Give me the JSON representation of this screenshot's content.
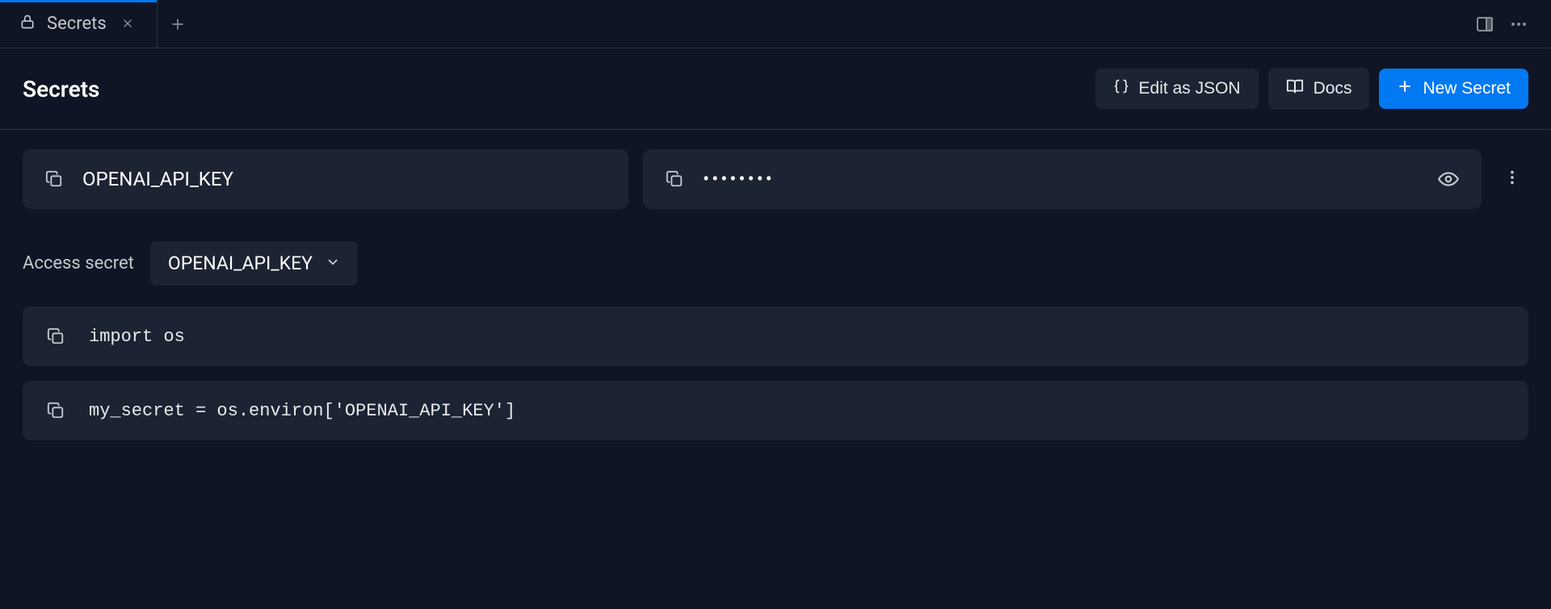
{
  "tab": {
    "label": "Secrets"
  },
  "header": {
    "title": "Secrets",
    "edit_json_label": "Edit as JSON",
    "docs_label": "Docs",
    "new_secret_label": "New Secret"
  },
  "secret": {
    "key": "OPENAI_API_KEY",
    "masked_value": "••••••••"
  },
  "access": {
    "label": "Access secret",
    "selected": "OPENAI_API_KEY"
  },
  "code": {
    "line1": "import os",
    "line2": "my_secret = os.environ['OPENAI_API_KEY']"
  }
}
